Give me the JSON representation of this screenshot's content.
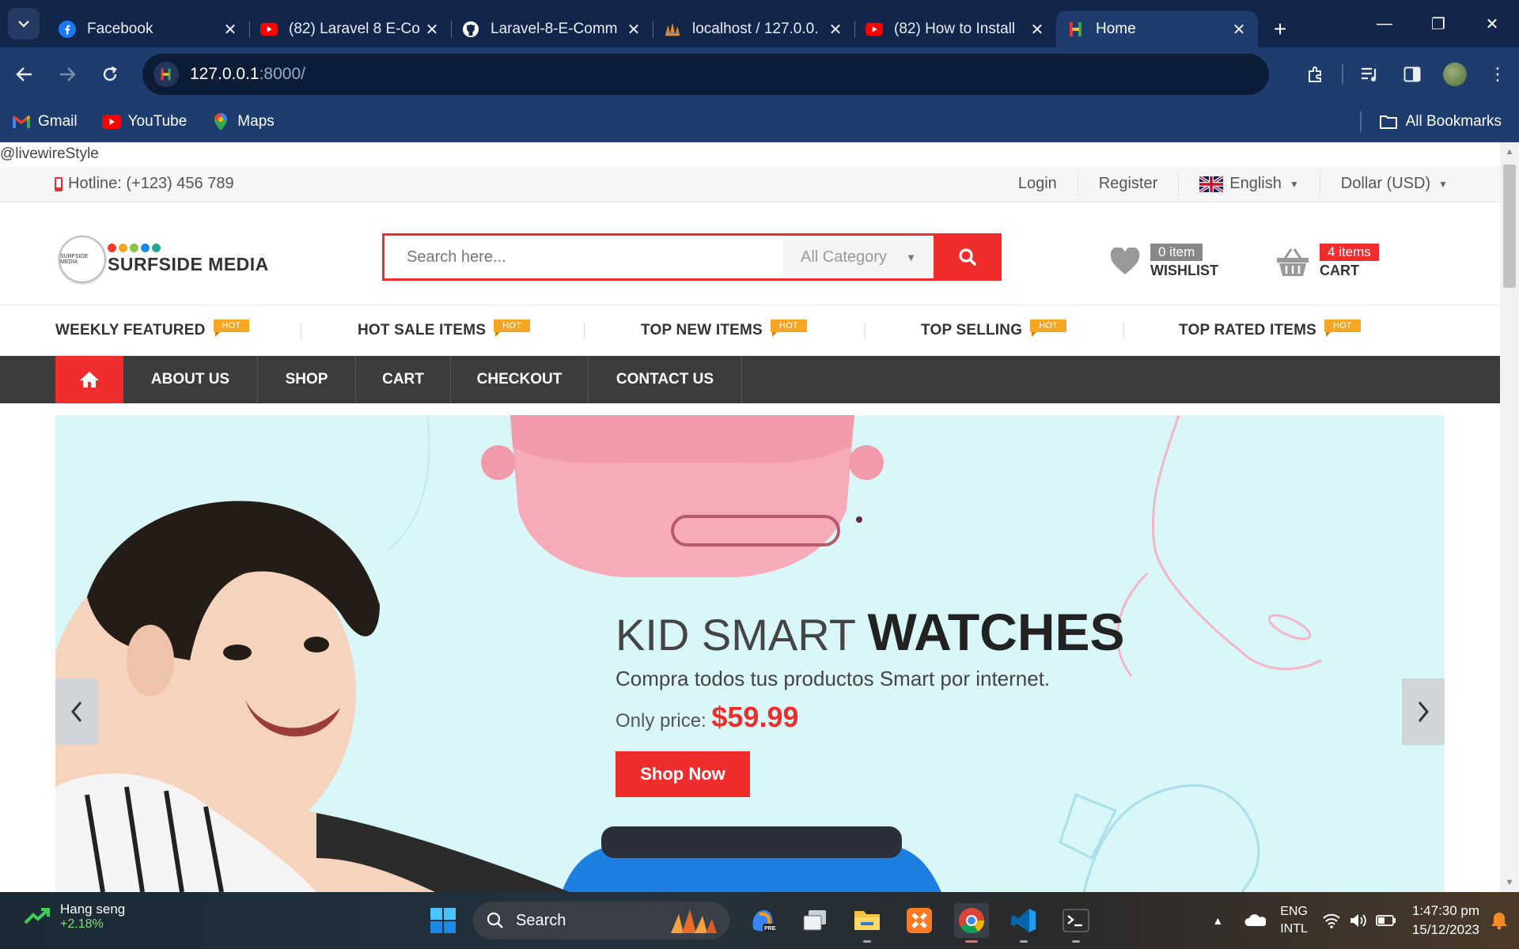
{
  "browser": {
    "tabs": [
      {
        "title": "Facebook",
        "icon": "facebook-icon",
        "active": false
      },
      {
        "title": "(82) Laravel 8 E-Co",
        "icon": "youtube-icon",
        "active": false
      },
      {
        "title": "Laravel-8-E-Comm",
        "icon": "github-icon",
        "active": false
      },
      {
        "title": "localhost / 127.0.0.",
        "icon": "phpmyadmin-icon",
        "active": false
      },
      {
        "title": "(82) How to Install",
        "icon": "youtube-icon",
        "active": false
      },
      {
        "title": "Home",
        "icon": "site-icon",
        "active": true
      }
    ],
    "url_host": "127.0.0.1",
    "url_rest": ":8000/",
    "bookmarks": [
      {
        "label": "Gmail",
        "icon": "gmail-icon"
      },
      {
        "label": "YouTube",
        "icon": "youtube-icon"
      },
      {
        "label": "Maps",
        "icon": "maps-icon"
      }
    ],
    "all_bookmarks": "All Bookmarks"
  },
  "page": {
    "debug_text": "@livewireStyle",
    "hotline": "Hotline: (+123) 456 789",
    "login": "Login",
    "register": "Register",
    "language": "English",
    "currency": "Dollar (USD)",
    "logo_name": "SURFSIDE MEDIA",
    "logo_small": "SURFSIDE MEDIA",
    "logo_dot_colors": [
      "#ef3b2d",
      "#f5a623",
      "#8bc34a",
      "#1e88e5",
      "#26a69a"
    ],
    "search_placeholder": "Search here...",
    "category": "All Category",
    "wishlist_badge": "0 item",
    "wishlist_label": "WISHLIST",
    "cart_badge": "4 items",
    "cart_label": "CART",
    "hot_label": "HOT",
    "featured": [
      "WEEKLY FEATURED",
      "HOT SALE ITEMS",
      "TOP NEW ITEMS",
      "TOP SELLING",
      "TOP RATED ITEMS"
    ],
    "nav": [
      "ABOUT US",
      "SHOP",
      "CART",
      "CHECKOUT",
      "CONTACT US"
    ],
    "slide": {
      "title_light": "KID SMART",
      "title_bold": "WATCHES",
      "subtitle": "Compra todos tus productos Smart por internet.",
      "price_label": "Only price:",
      "price": "$59.99",
      "button": "Shop Now"
    },
    "colors": {
      "accent": "#ef2d2d",
      "nav_bg": "#3c3c3c",
      "hot": "#f5a623"
    }
  },
  "taskbar": {
    "weather_title": "Hang seng",
    "weather_change": "+2.18%",
    "search": "Search",
    "lang_top": "ENG",
    "lang_bottom": "INTL",
    "time": "1:47:30 pm",
    "date": "15/12/2023"
  }
}
